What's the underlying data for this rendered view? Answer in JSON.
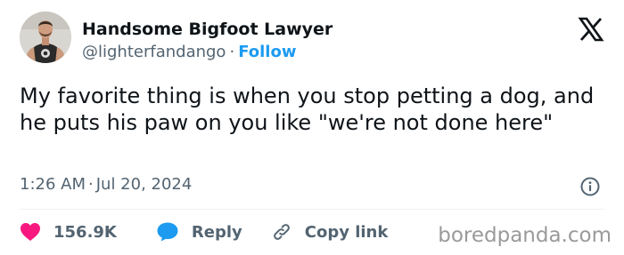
{
  "author": {
    "name": "Handsome Bigfoot Lawyer",
    "handle": "@lighterfandango",
    "separator": "·",
    "follow_label": "Follow"
  },
  "tweet": {
    "text": "My favorite thing is when you stop petting a dog, and he puts his paw on you like \"we're not done here\"",
    "time": "1:26 AM",
    "separator": "·",
    "date": "Jul 20, 2024"
  },
  "actions": {
    "like_count": "156.9K",
    "reply_label": "Reply",
    "copy_link_label": "Copy link"
  },
  "icons": {
    "logo": "x-logo-icon",
    "info": "info-icon",
    "like": "heart-icon",
    "reply": "speech-bubble-icon",
    "copy_link": "link-icon"
  },
  "colors": {
    "text": "#0f1419",
    "secondary": "#536471",
    "accent": "#1d9bf0",
    "like": "#f91880",
    "watermark": "#9a9a9a"
  },
  "watermark": "boredpanda.com"
}
